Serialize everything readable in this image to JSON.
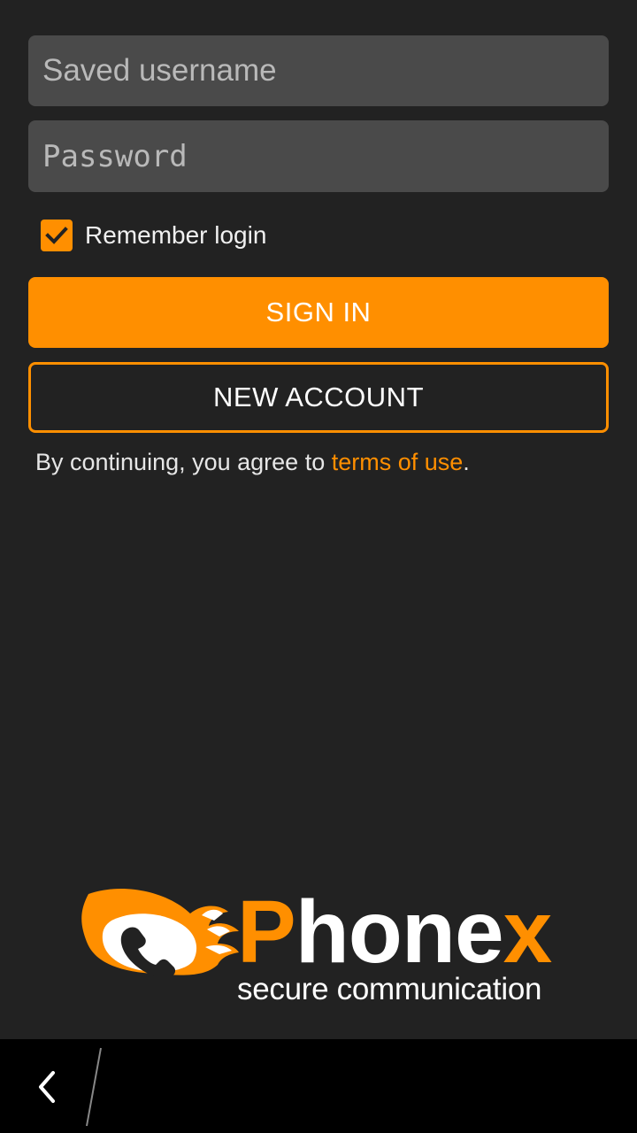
{
  "login": {
    "username_placeholder": "Saved username",
    "password_placeholder": "Password",
    "remember_label": "Remember login",
    "remember_checked": true,
    "sign_in_label": "SIGN IN",
    "new_account_label": "NEW ACCOUNT",
    "terms_prefix": "By continuing, you agree to ",
    "terms_link": "terms of use",
    "terms_suffix": "."
  },
  "brand": {
    "name_first": "P",
    "name_middle": "hone",
    "name_last": "x",
    "tagline": "secure communication",
    "logo_icon": "phone-flame-logo-icon"
  },
  "navbar": {
    "back_icon": "chevron-left-icon"
  },
  "colors": {
    "accent": "#ff8f00",
    "background": "#222222",
    "field": "#4a4a4a"
  }
}
